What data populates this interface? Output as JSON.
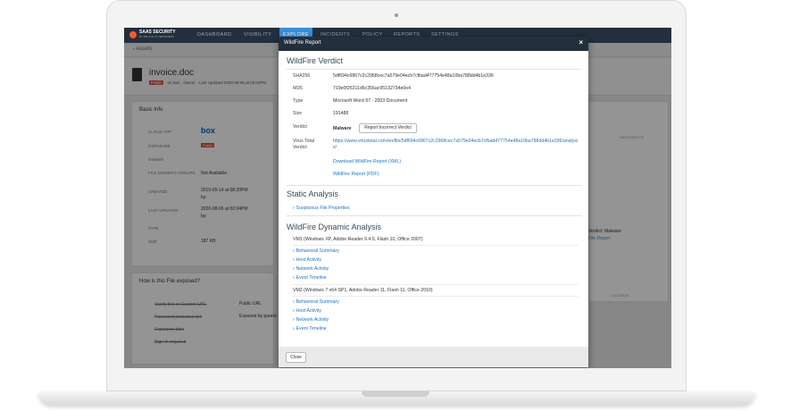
{
  "nav": {
    "brand": "SAAS SECURITY",
    "brand_sub": "BY PALO ALTO NETWORKS",
    "items": [
      "DASHBOARD",
      "VISIBILITY",
      "EXPLORE",
      "INCIDENTS",
      "POLICY",
      "REPORTS",
      "SETTINGS"
    ]
  },
  "background": {
    "back": "Assets",
    "file_name": "invoice.doc",
    "public_badge": "Public",
    "meta_box": "on Box",
    "meta_owner": "Owner",
    "meta_updated": "Last Updated 2020-08-06 at 02:04PM",
    "basic_info": "Basic Info",
    "labels": [
      "CLOUD APP",
      "EXPOSURE",
      "OWNER",
      "FILE OWNER'S GROUPS",
      "CREATED",
      "LAST UPDATED",
      "TYPE",
      "SIZE"
    ],
    "cloud_app": "box",
    "exposure": "Public",
    "groups": "Not Available",
    "created": "2019-05-14 at 08:20PM",
    "created_by": "by:",
    "updated": "2020-08-06 at 02:04PM",
    "updated_by": "by:",
    "size": "187 KB",
    "exposed_title": "How is this File exposed?",
    "exposed_items": [
      "Vanity link or Custom URL",
      "Password protected link",
      "Expiration date",
      "Sign-in required"
    ],
    "public_url": "Public URL",
    "exposed_by_parent": "Exposed by parent",
    "assigned_to": "ASSIGNED TO",
    "verdict_malware": "Verdict: Malware",
    "file_report": "File Report",
    "location": "LOCATION"
  },
  "modal": {
    "title": "WildFire Report",
    "close_x": "×",
    "verdict_title": "WildFire Verdict",
    "rows": [
      {
        "k": "SHA256",
        "v": "5df694c6867c2c2968cec7a579e04ecb7cfbad477754e48a10ba788dd4b1e336"
      },
      {
        "k": "MD5",
        "v": "719e0f26311d6c356ac95132734e0e4"
      },
      {
        "k": "Type",
        "v": "Microsoft Word 97 - 2003 Document"
      },
      {
        "k": "Size",
        "v": "191488"
      }
    ],
    "verdict_label": "Verdict",
    "verdict_value": "Malware",
    "report_incorrect": "Report Incorrect Verdict",
    "vt_label": "Virus Total Verdict",
    "vt_link": "https://www.virustotal.com/en/file/5df694c6867c2c2968cec7a579e04ecb7cfbad477754e48a10ba788dd4b1e336/analysis/",
    "download_xml": "Download WildFire Report (XML)",
    "report_pdf": "WildFire Report (PDF)",
    "static_title": "Static Analysis",
    "static_item": "Suspicious File Properties",
    "dynamic_title": "WildFire Dynamic Analysis",
    "vm1": "VM1 (Windows XP, Adobe Reader 9.4.0, Flash 10, Office 2007)",
    "vm2": "VM2 (Windows 7 x64 SP1, Adobe Reader 11, Flash 11, Office 2010)",
    "vm_items": [
      "Behavioral Summary",
      "Host Activity",
      "Network Activity",
      "Event Timeline"
    ],
    "close_button": "Close"
  }
}
